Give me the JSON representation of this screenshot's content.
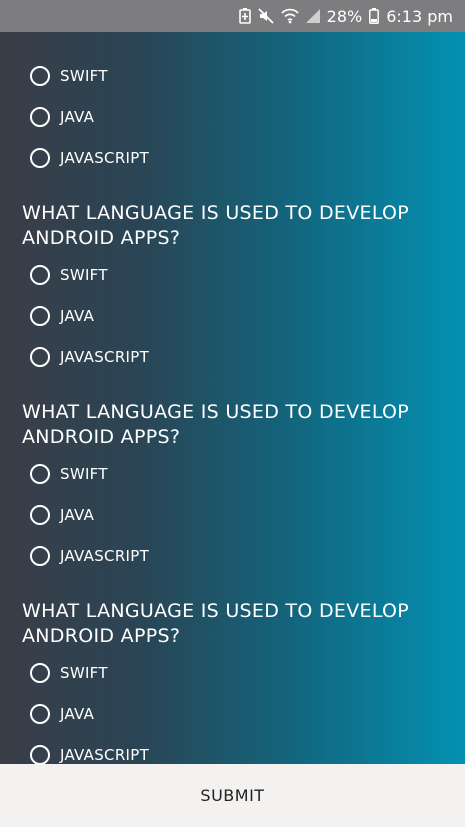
{
  "statusbar": {
    "icons": [
      "battery-saver-icon",
      "mute-icon",
      "wifi-icon",
      "signal-icon"
    ],
    "battery_percent": "28%",
    "time": "6:13 pm"
  },
  "questions": [
    {
      "text": "",
      "options": [
        "SWIFT",
        "JAVA",
        "JAVASCRIPT"
      ]
    },
    {
      "text": "WHAT LANGUAGE IS USED TO DEVELOP ANDROID APPS?",
      "options": [
        "SWIFT",
        "JAVA",
        "JAVASCRIPT"
      ]
    },
    {
      "text": "WHAT LANGUAGE IS USED TO DEVELOP ANDROID APPS?",
      "options": [
        "SWIFT",
        "JAVA",
        "JAVASCRIPT"
      ]
    },
    {
      "text": "WHAT LANGUAGE IS USED TO DEVELOP ANDROID APPS?",
      "options": [
        "SWIFT",
        "JAVA",
        "JAVASCRIPT"
      ]
    }
  ],
  "submit_label": "SUBMIT",
  "colors": {
    "statusbar_bg": "#7d7d7f",
    "gradient_start": "#3a3d47",
    "gradient_end": "#0391b2",
    "bottom_bar_bg": "#f3f2f1"
  }
}
